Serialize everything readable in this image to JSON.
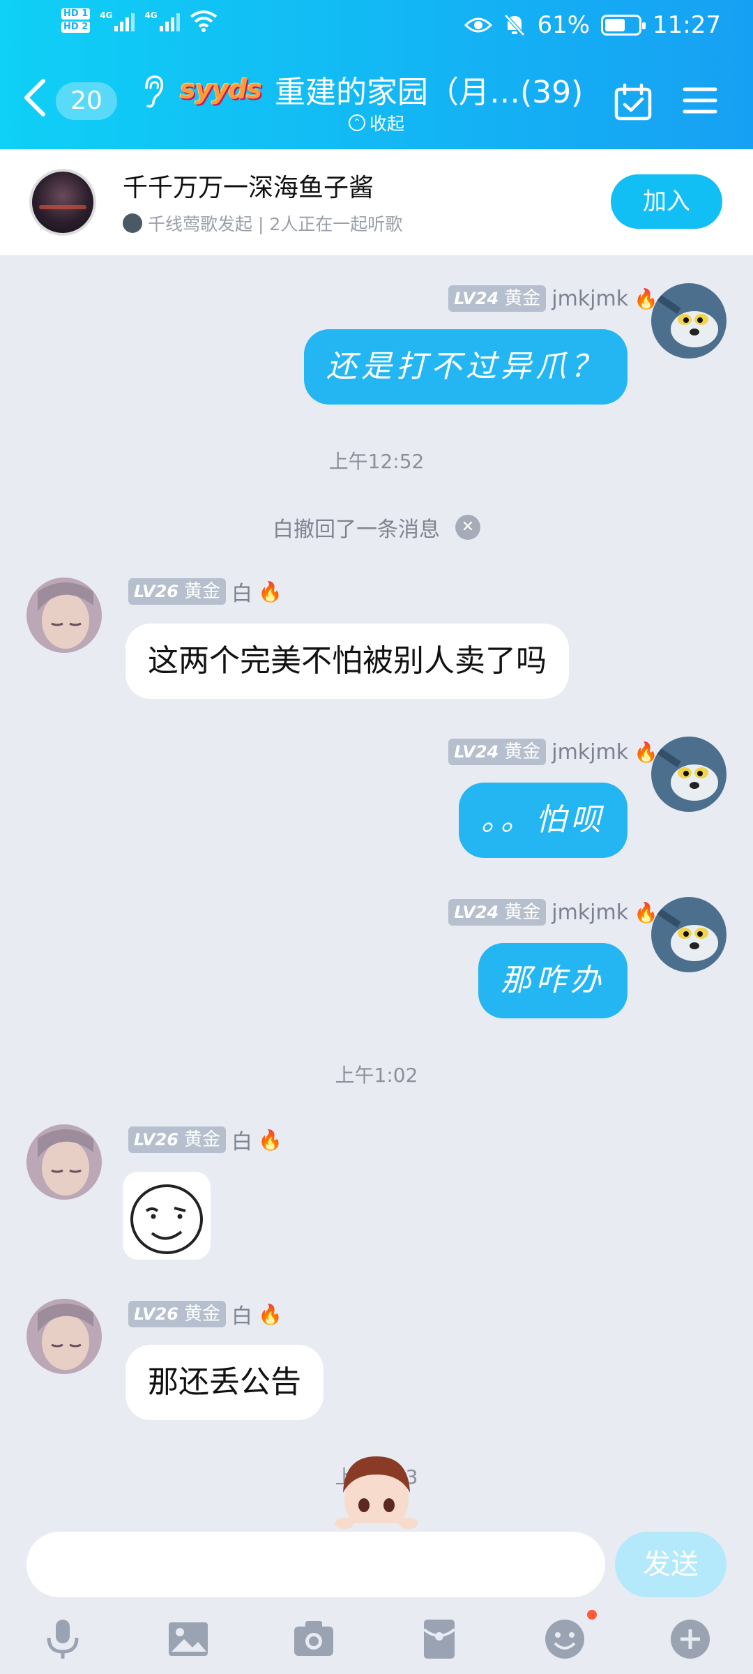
{
  "status_bar": {
    "hd_1": "HD 1",
    "hd_2": "HD 2",
    "net_1": "4G",
    "net_2": "4G",
    "battery": "61%",
    "battery_level": 0.61,
    "time": "11:27"
  },
  "header": {
    "unread_count": "20",
    "group_badge_text": "syyds",
    "group_title": "重建的家园（月…(39)",
    "collapse_label": "收起",
    "accent": "#13b6f4"
  },
  "listen_together": {
    "song_title": "千千万万一深海鱼子酱",
    "subtitle": "千线莺歌发起 | 2人正在一起听歌",
    "join_label": "加入"
  },
  "messages": [
    {
      "side": "out",
      "level": "LV24",
      "rank": "黄金",
      "nick": "jmkjmk",
      "text": "还是打不过异爪？"
    },
    {
      "type": "time",
      "text": "上午12:52"
    },
    {
      "type": "recall",
      "text": "白撤回了一条消息"
    },
    {
      "side": "in",
      "level": "LV26",
      "rank": "黄金",
      "nick": "白",
      "text": "这两个完美不怕被别人卖了吗"
    },
    {
      "side": "out",
      "level": "LV24",
      "rank": "黄金",
      "nick": "jmkjmk",
      "text": "。。怕呗"
    },
    {
      "side": "out",
      "level": "LV24",
      "rank": "黄金",
      "nick": "jmkjmk",
      "text": "那咋办"
    },
    {
      "type": "time",
      "text": "上午1:02"
    },
    {
      "side": "in",
      "level": "LV26",
      "rank": "黄金",
      "nick": "白",
      "sticker": "smirk-face"
    },
    {
      "side": "in",
      "level": "LV26",
      "rank": "黄金",
      "nick": "白",
      "text": "那还丢公告"
    },
    {
      "type": "time",
      "text": "上午1:03"
    }
  ],
  "input": {
    "placeholder": "",
    "send_label": "发送"
  },
  "toolbar": [
    "mic-icon",
    "image-icon",
    "camera-icon",
    "red-packet-icon",
    "emoji-icon",
    "plus-icon"
  ]
}
